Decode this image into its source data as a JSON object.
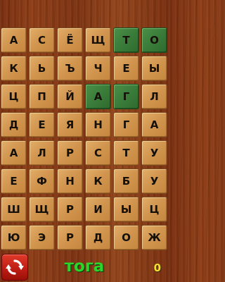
{
  "board": {
    "rows": [
      [
        "А",
        "С",
        "Ё",
        "Щ",
        "Т",
        "О"
      ],
      [
        "К",
        "Ь",
        "Ъ",
        "Ч",
        "Е",
        "Ы"
      ],
      [
        "Ц",
        "П",
        "Й",
        "А",
        "Г",
        "Л"
      ],
      [
        "Д",
        "Е",
        "Я",
        "Н",
        "Г",
        "А"
      ],
      [
        "А",
        "Л",
        "Р",
        "С",
        "Т",
        "У"
      ],
      [
        "Е",
        "Ф",
        "Н",
        "К",
        "Б",
        "У"
      ],
      [
        "Ш",
        "Щ",
        "Р",
        "И",
        "Ы",
        "Ц"
      ],
      [
        "Ю",
        "Э",
        "Р",
        "Д",
        "О",
        "Ж"
      ]
    ],
    "selected_cells": [
      [
        0,
        4
      ],
      [
        0,
        5
      ],
      [
        2,
        3
      ],
      [
        2,
        4
      ]
    ],
    "tile_color": "#d29650",
    "selected_color": "#3a7c3a"
  },
  "bottom_bar": {
    "reset_icon": "refresh-icon",
    "reset_color": "#c01e14",
    "current_word": "тога",
    "current_word_color": "#2bd62b",
    "score": "0",
    "score_color": "#f2e02a"
  }
}
